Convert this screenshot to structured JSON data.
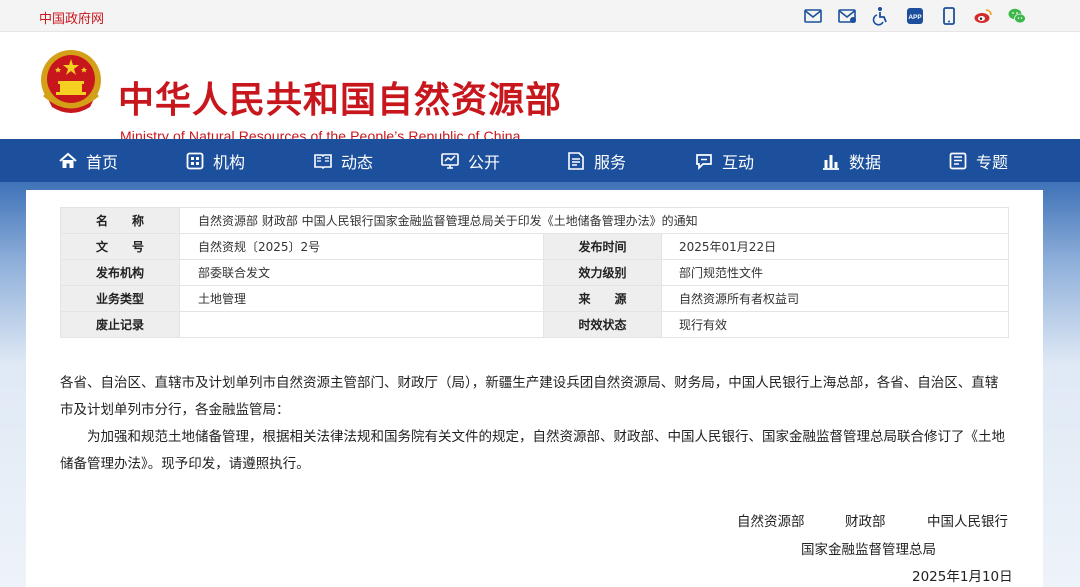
{
  "top": {
    "gov_link": "中国政府网",
    "icons": [
      "mail-icon",
      "mail-subscribe-icon",
      "accessibility-icon",
      "app-icon",
      "mobile-icon",
      "weibo-icon",
      "wechat-icon"
    ],
    "app_label": "APP"
  },
  "header": {
    "title_cn": "中华人民共和国自然资源部",
    "title_en": "Ministry of Natural Resources of the People’s Republic of China"
  },
  "nav": {
    "items": [
      {
        "label": "首页",
        "icon": "home-icon"
      },
      {
        "label": "机构",
        "icon": "organization-icon"
      },
      {
        "label": "动态",
        "icon": "news-icon"
      },
      {
        "label": "公开",
        "icon": "disclosure-icon"
      },
      {
        "label": "服务",
        "icon": "service-icon"
      },
      {
        "label": "互动",
        "icon": "interaction-icon"
      },
      {
        "label": "数据",
        "icon": "data-chart-icon"
      },
      {
        "label": "专题",
        "icon": "topic-icon"
      }
    ]
  },
  "info": {
    "name_label": "名　　称",
    "name_value": "自然资源部 财政部 中国人民银行国家金融监督管理总局关于印发《土地储备管理办法》的通知",
    "doc_no_label": "文　　号",
    "doc_no_value": "自然资规〔2025〕2号",
    "publish_time_label": "发布时间",
    "publish_time_value": "2025年01月22日",
    "issuer_label": "发布机构",
    "issuer_value": "部委联合发文",
    "level_label": "效力级别",
    "level_value": "部门规范性文件",
    "category_label": "业务类型",
    "category_value": "土地管理",
    "source_label": "来　　源",
    "source_value": "自然资源所有者权益司",
    "abolish_label": "废止记录",
    "abolish_value": "",
    "status_label": "时效状态",
    "status_value": "现行有效"
  },
  "body": {
    "p1": "各省、自治区、直辖市及计划单列市自然资源主管部门、财政厅（局），新疆生产建设兵团自然资源局、财务局，中国人民银行上海总部，各省、自治区、直辖市及计划单列市分行，各金融监管局：",
    "p2": "为加强和规范土地储备管理，根据相关法律法规和国务院有关文件的规定，自然资源部、财政部、中国人民银行、国家金融监督管理总局联合修订了《土地储备管理办法》。现予印发，请遵照执行。"
  },
  "signature": {
    "org1": "自然资源部",
    "org2": "财政部",
    "org3": "中国人民银行",
    "org4": "国家金融监督管理总局",
    "date": "2025年1月10日"
  },
  "colors": {
    "brand_red": "#c8161d",
    "nav_blue": "#1c4f9c"
  }
}
